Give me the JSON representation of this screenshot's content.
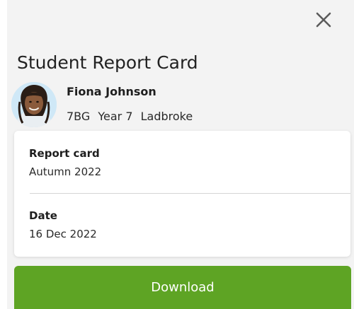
{
  "header": {
    "close_icon": "close-icon",
    "title": "Student Report Card"
  },
  "student": {
    "avatar_icon": "student-avatar",
    "name": "Fiona Johnson",
    "form": "7BG",
    "year": "Year 7",
    "house": "Ladbroke"
  },
  "details": {
    "report_card_label": "Report card",
    "report_card_value": "Autumn 2022",
    "date_label": "Date",
    "date_value": "16 Dec 2022"
  },
  "actions": {
    "download_label": "Download"
  },
  "colors": {
    "accent": "#5ea424",
    "background": "#f3f3f3",
    "card": "#ffffff",
    "text": "#1f1f1f"
  }
}
